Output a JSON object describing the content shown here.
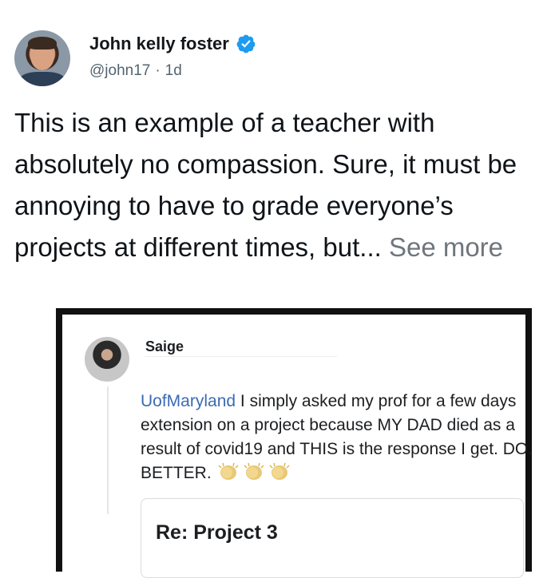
{
  "tweet": {
    "author_name": "John kelly foster",
    "handle": "@john17",
    "separator": "·",
    "age": "1d",
    "text": "This is an example of a teacher with absolutely no compassion. Sure, it must be annoying to have to grade everyone’s projects at different times, but...",
    "see_more": "See more"
  },
  "embedded_post": {
    "author": "Saige",
    "mention": "UofMaryland",
    "body": "I simply asked my prof for a few days extension on a project because MY DAD died as a result of covid19 and THIS is the response I get. DO. BETTER.",
    "reaction_icons": [
      "clapping-hands-icon",
      "clapping-hands-icon",
      "clapping-hands-icon"
    ],
    "reply_card": {
      "subject": "Re: Project 3"
    }
  },
  "colors": {
    "verified_badge": "#1d9bf0",
    "mention": "#3b6bb4",
    "secondary_text": "#536471"
  }
}
